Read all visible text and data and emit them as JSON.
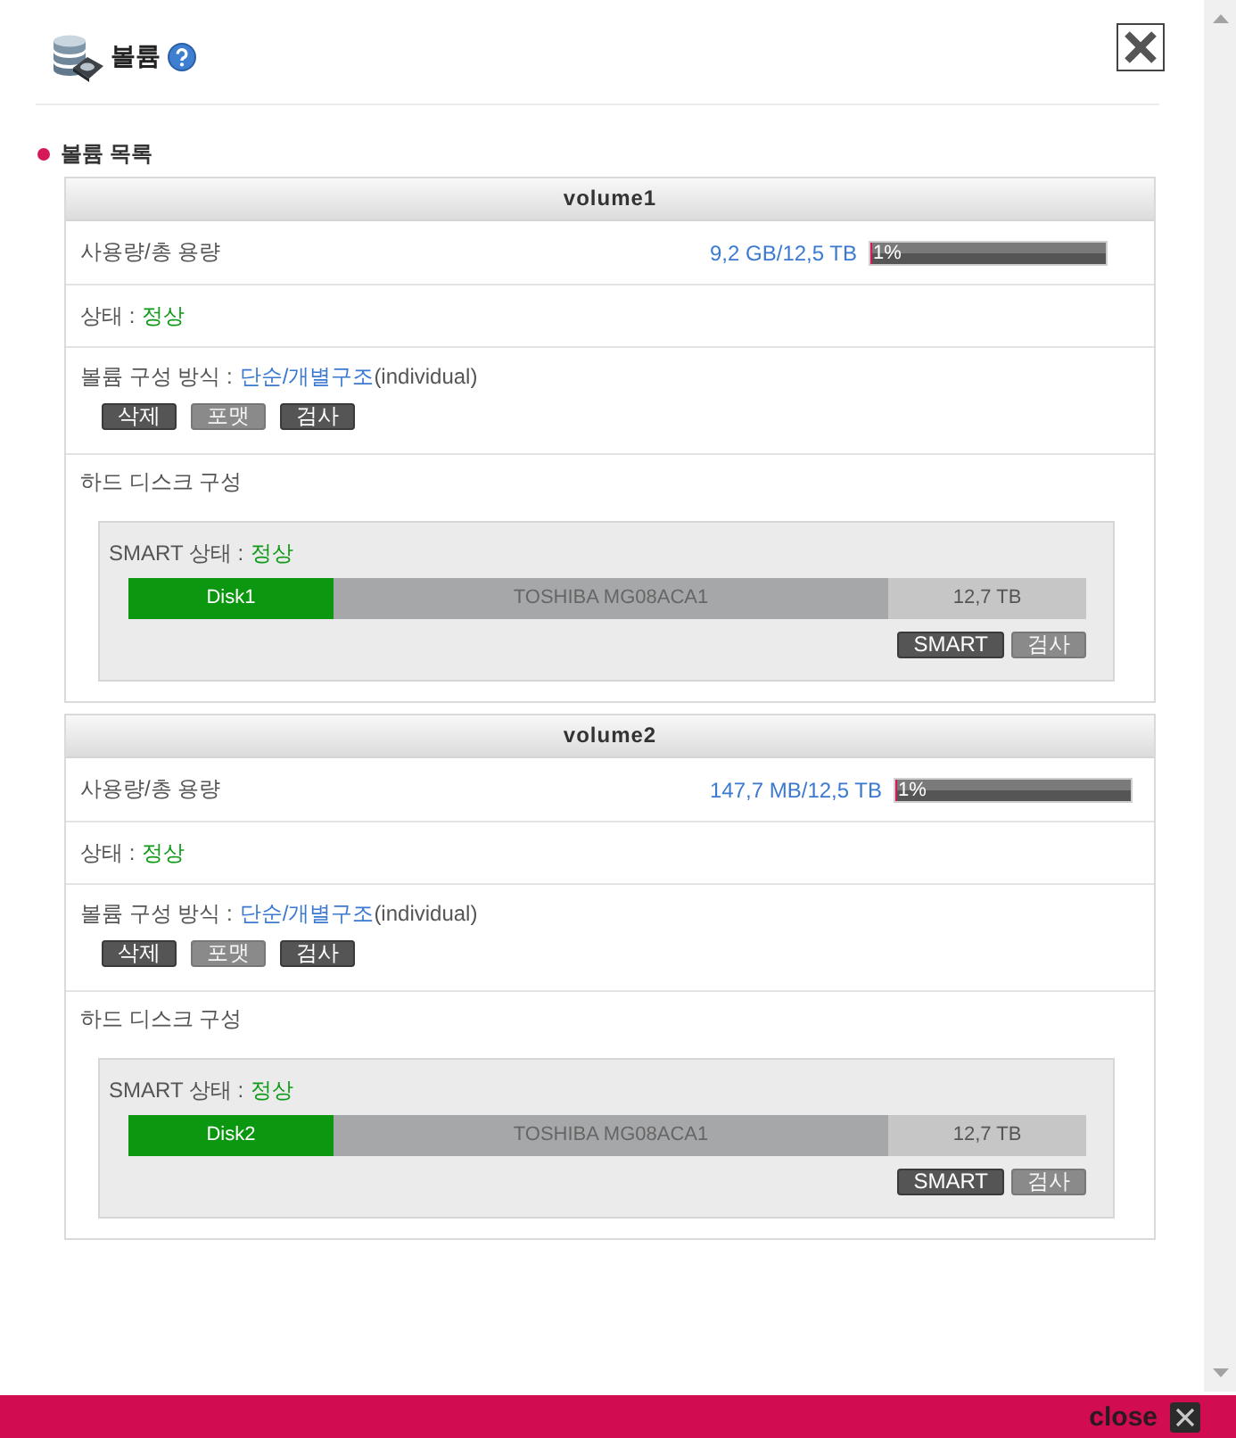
{
  "header": {
    "title": "볼륨"
  },
  "section": {
    "title": "볼륨 목록"
  },
  "volumes": [
    {
      "name": "volume1",
      "usage_label": "사용량/총 용량",
      "usage": "9,2 GB/12,5 TB",
      "percent": "1%",
      "level": 0.01,
      "status_label": "상태 :",
      "status": "정상",
      "config_label": "볼륨 구성 방식 :",
      "config_type": "단순/개별구조",
      "config_note": "(individual)",
      "actions": [
        {
          "label": "삭제",
          "disabled": false
        },
        {
          "label": "포맷",
          "disabled": true
        },
        {
          "label": "검사",
          "disabled": false
        }
      ],
      "disks_label": "하드 디스크 구성",
      "disks": [
        {
          "smart_label": "SMART 상태 :",
          "smart_status": "정상",
          "name": "Disk1",
          "model": "TOSHIBA MG08ACA1",
          "size": "12,7 TB",
          "actions": [
            {
              "label": "SMART",
              "disabled": false
            },
            {
              "label": "검사",
              "disabled": true
            }
          ]
        }
      ]
    },
    {
      "name": "volume2",
      "usage_label": "사용량/총 용량",
      "usage": "147,7 MB/12,5 TB",
      "percent": "1%",
      "level": 0.01,
      "status_label": "상태 :",
      "status": "정상",
      "config_label": "볼륨 구성 방식 :",
      "config_type": "단순/개별구조",
      "config_note": "(individual)",
      "actions": [
        {
          "label": "삭제",
          "disabled": false
        },
        {
          "label": "포맷",
          "disabled": true
        },
        {
          "label": "검사",
          "disabled": false
        }
      ],
      "disks_label": "하드 디스크 구성",
      "disks": [
        {
          "smart_label": "SMART 상태 :",
          "smart_status": "정상",
          "name": "Disk2",
          "model": "TOSHIBA MG08ACA1",
          "size": "12,7 TB",
          "actions": [
            {
              "label": "SMART",
              "disabled": false
            },
            {
              "label": "검사",
              "disabled": true
            }
          ]
        }
      ]
    }
  ],
  "footer": {
    "close_label": "close"
  }
}
